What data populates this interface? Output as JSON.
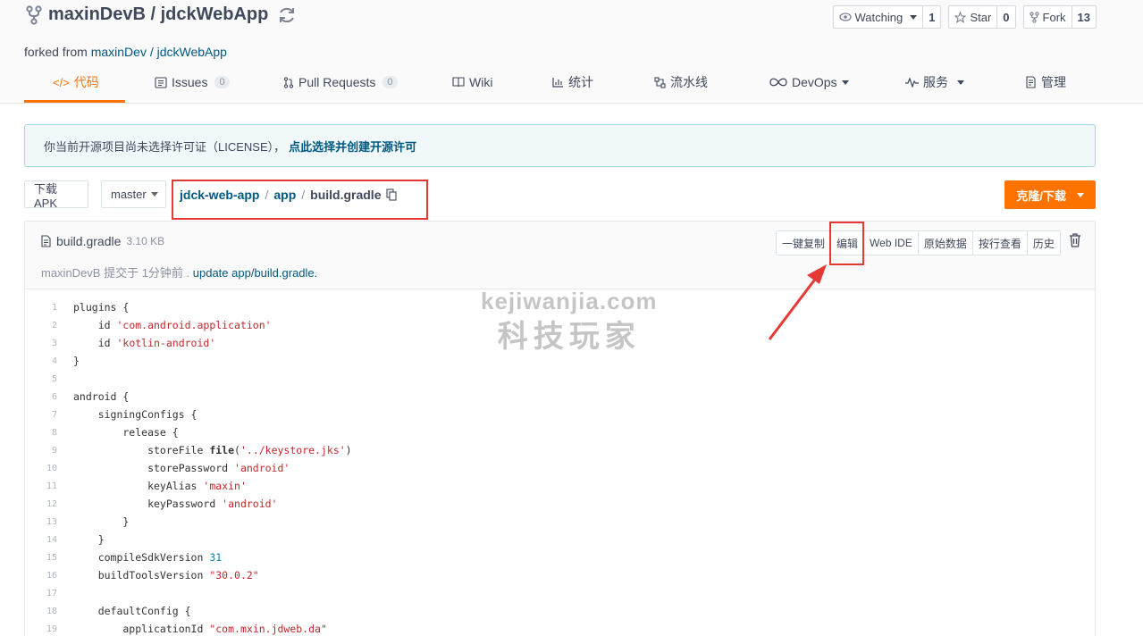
{
  "repo": {
    "owner": "maxinDevB",
    "separator": " / ",
    "name": "jdckWebApp",
    "forked_prefix": "forked from ",
    "forked_source": "maxinDev / jdckWebApp"
  },
  "actions": {
    "watch_label": "Watching",
    "watch_count": "1",
    "star_label": "Star",
    "star_count": "0",
    "fork_label": "Fork",
    "fork_count": "13"
  },
  "tabs": [
    {
      "label": "代码",
      "icon": "code-icon"
    },
    {
      "label": "Issues",
      "badge": "0",
      "icon": "issues-icon"
    },
    {
      "label": "Pull Requests",
      "badge": "0",
      "icon": "pull-request-icon"
    },
    {
      "label": "Wiki",
      "icon": "wiki-icon"
    },
    {
      "label": "统计",
      "icon": "stats-icon"
    },
    {
      "label": "流水线",
      "icon": "pipeline-icon"
    },
    {
      "label": "DevOps",
      "icon": "infinity-icon"
    },
    {
      "label": "服务",
      "icon": "pulse-icon"
    },
    {
      "label": "管理",
      "icon": "manage-icon"
    }
  ],
  "license": {
    "text": "你当前开源项目尚未选择许可证（LICENSE），",
    "link": "点此选择并创建开源许可"
  },
  "toolbar": {
    "download_apk": "下载APK",
    "branch": "master",
    "path_root": "jdck-web-app",
    "path_dir": "app",
    "path_file": "build.gradle",
    "path_sep": "/",
    "clone": "克隆/下载"
  },
  "file": {
    "name": "build.gradle",
    "size": "3.10 KB",
    "commit_author": "maxinDevB 提交于 1分钟前 . ",
    "commit_msg": "update app/build.gradle.",
    "buttons": [
      "一键复制",
      "编辑",
      "Web IDE",
      "原始数据",
      "按行查看",
      "历史"
    ]
  },
  "watermark": {
    "line1": "kejiwanjia.com",
    "line2": "科技玩家"
  },
  "colors": {
    "accent": "#fe7300",
    "link": "#005980",
    "highlight": "#e53935"
  },
  "code_lines": [
    [
      {
        "t": "plugins {"
      }
    ],
    [
      {
        "t": "    id "
      },
      {
        "t": "'com.android.application'",
        "c": "str"
      }
    ],
    [
      {
        "t": "    id "
      },
      {
        "t": "'kotlin-android'",
        "c": "str"
      }
    ],
    [
      {
        "t": "}"
      }
    ],
    [
      {
        "t": ""
      }
    ],
    [
      {
        "t": "android {"
      }
    ],
    [
      {
        "t": "    signingConfigs {"
      }
    ],
    [
      {
        "t": "        release {"
      }
    ],
    [
      {
        "t": "            storeFile "
      },
      {
        "t": "file",
        "c": "fn"
      },
      {
        "t": "("
      },
      {
        "t": "'../keystore.jks'",
        "c": "str"
      },
      {
        "t": ")"
      }
    ],
    [
      {
        "t": "            storePassword "
      },
      {
        "t": "'android'",
        "c": "str"
      }
    ],
    [
      {
        "t": "            keyAlias "
      },
      {
        "t": "'maxin'",
        "c": "str"
      }
    ],
    [
      {
        "t": "            keyPassword "
      },
      {
        "t": "'android'",
        "c": "str"
      }
    ],
    [
      {
        "t": "        }"
      }
    ],
    [
      {
        "t": "    }"
      }
    ],
    [
      {
        "t": "    compileSdkVersion "
      },
      {
        "t": "31",
        "c": "num"
      }
    ],
    [
      {
        "t": "    buildToolsVersion "
      },
      {
        "t": "\"30.0.2\"",
        "c": "str"
      }
    ],
    [
      {
        "t": ""
      }
    ],
    [
      {
        "t": "    defaultConfig {"
      }
    ],
    [
      {
        "t": "        applicationId "
      },
      {
        "t": "\"com.mxin.jdweb.da\"",
        "c": "str"
      }
    ]
  ]
}
